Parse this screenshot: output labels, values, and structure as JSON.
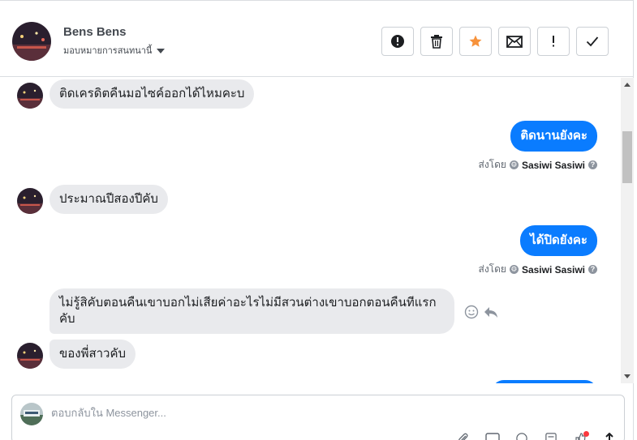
{
  "header": {
    "name": "Bens Bens",
    "assign_label": "มอบหมายการสนทนานี้",
    "actions": [
      {
        "icon": "alert-circle-icon",
        "label": "Mark as spam"
      },
      {
        "icon": "trash-icon",
        "label": "Delete"
      },
      {
        "icon": "star-icon",
        "label": "Star"
      },
      {
        "icon": "envelope-icon",
        "label": "Mark as unread"
      },
      {
        "icon": "exclamation-icon",
        "label": "Follow up"
      },
      {
        "icon": "check-icon",
        "label": "Done"
      }
    ]
  },
  "thread": {
    "messages": [
      {
        "dir": "in",
        "text": "ติดเครดิตคืนมอไซค์ออกได้ไหมคะบ"
      },
      {
        "dir": "out",
        "text": "ติดนานยังคะ",
        "sent_by_prefix": "ส่งโดย",
        "sent_by": "Sasiwi Sasiwi"
      },
      {
        "dir": "in",
        "text": "ประมาณปีสองปีคับ"
      },
      {
        "dir": "out",
        "text": "ได้ปิดยังคะ",
        "sent_by_prefix": "ส่งโดย",
        "sent_by": "Sasiwi Sasiwi"
      },
      {
        "dir": "in",
        "text": "ไม่รู้สิคับตอนคืนเขาบอกไม่เสียค่าอะไรไม่มีสวนต่างเขาบอกตอนคืนทีแรกคับ"
      },
      {
        "dir": "in",
        "text": "ของพี่สาวคับ"
      }
    ]
  },
  "composer": {
    "placeholder": "ตอบกลับใน Messenger..."
  },
  "colors": {
    "accent": "#0a7cff",
    "incoming_bubble": "#e9eaed",
    "star": "#f7923b",
    "notification_dot": "#fa383e"
  }
}
